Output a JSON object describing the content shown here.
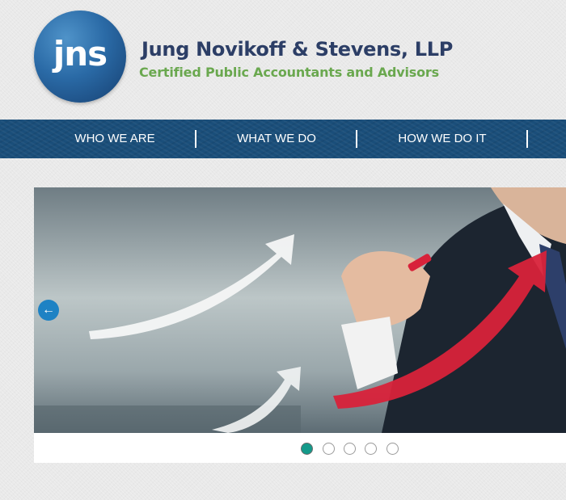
{
  "header": {
    "logo_text": "jns",
    "company_name": "Jung Novikoff & Stevens, LLP",
    "tagline": "Certified Public Accountants and Advisors"
  },
  "nav": {
    "items": [
      {
        "label": "WHO WE ARE"
      },
      {
        "label": "WHAT WE DO"
      },
      {
        "label": "HOW WE DO IT"
      }
    ]
  },
  "slider": {
    "prev_icon": "arrow-left-icon",
    "dots_count": 5,
    "active_dot": 1
  },
  "colors": {
    "nav_bg": "#1a4e7a",
    "company_name": "#2c3e66",
    "tagline": "#6aa84f",
    "active_dot": "#149a8a",
    "arrow_btn": "#1e82c4"
  }
}
